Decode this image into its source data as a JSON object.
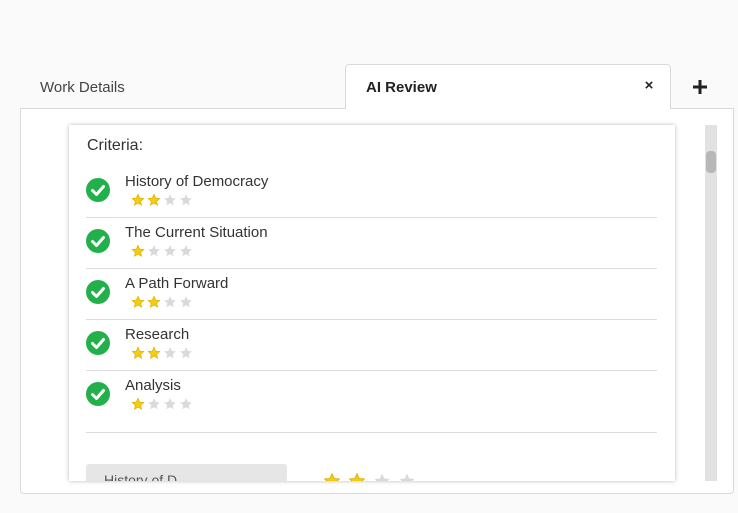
{
  "tabs": {
    "work_details": "Work Details",
    "ai_review": "AI Review",
    "close_symbol": "×",
    "add_symbol": "+"
  },
  "review": {
    "criteria_title": "Criteria:",
    "items": [
      {
        "name": "History of Democracy",
        "rating": 2,
        "max": 4,
        "status": "check-circle-icon"
      },
      {
        "name": "The Current Situation",
        "rating": 1,
        "max": 4,
        "status": "check-circle-icon"
      },
      {
        "name": "A Path Forward",
        "rating": 2,
        "max": 4,
        "status": "check-circle-icon"
      },
      {
        "name": "Research",
        "rating": 2,
        "max": 4,
        "status": "check-circle-icon"
      },
      {
        "name": "Analysis",
        "rating": 1,
        "max": 4,
        "status": "check-circle-icon"
      }
    ],
    "peek_label": "History of D",
    "peek_rating": 2,
    "peek_max": 4
  },
  "colors": {
    "check": "#22b04b",
    "star_filled": "#f5cd0c",
    "star_filled_stroke": "#d9a800",
    "star_empty": "#d9d9d9"
  }
}
